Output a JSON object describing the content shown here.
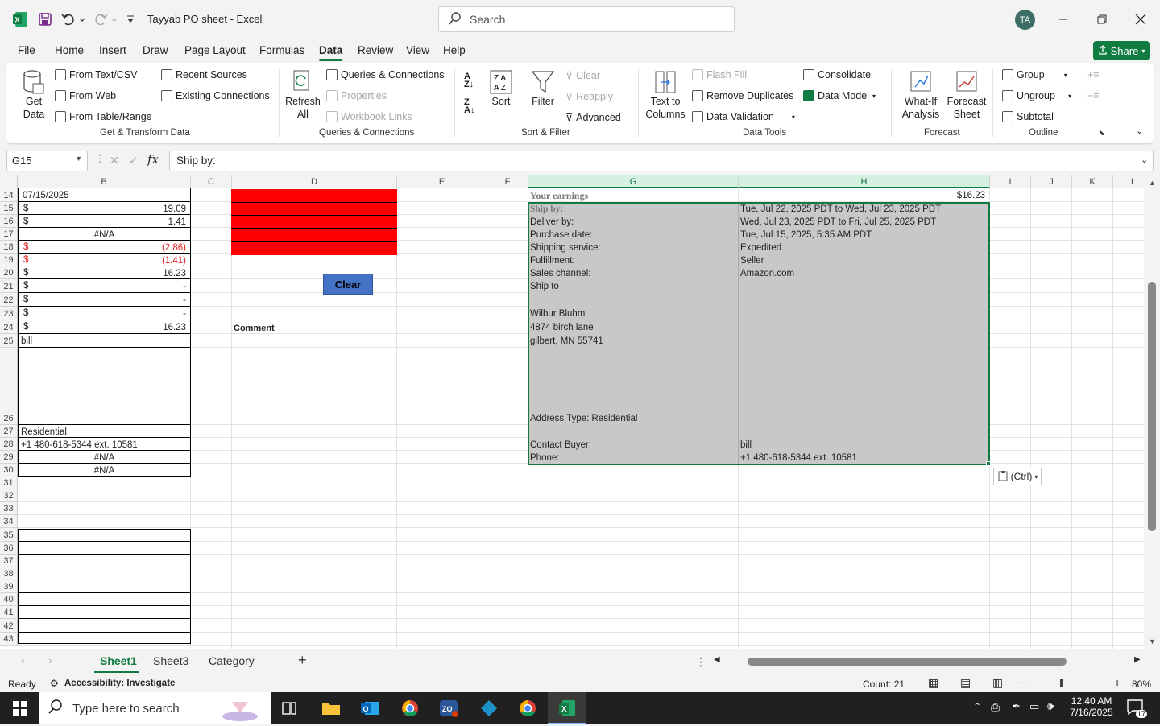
{
  "window": {
    "title": "Tayyab PO sheet  -  Excel",
    "search_placeholder": "Search",
    "avatar": "TA"
  },
  "menu": [
    "File",
    "Home",
    "Insert",
    "Draw",
    "Page Layout",
    "Formulas",
    "Data",
    "Review",
    "View",
    "Help"
  ],
  "share_label": "Share",
  "ribbon": {
    "get_data": "Get\nData",
    "from_text_csv": "From Text/CSV",
    "from_web": "From Web",
    "from_table_range": "From Table/Range",
    "recent_sources": "Recent Sources",
    "existing_connections": "Existing Connections",
    "refresh_all": "Refresh\nAll",
    "queries_connections": "Queries & Connections",
    "properties": "Properties",
    "workbook_links": "Workbook Links",
    "sort": "Sort",
    "filter": "Filter",
    "clear": "Clear",
    "reapply": "Reapply",
    "advanced": "Advanced",
    "text_to_columns": "Text to\nColumns",
    "flash_fill": "Flash Fill",
    "remove_duplicates": "Remove Duplicates",
    "data_validation": "Data Validation",
    "consolidate": "Consolidate",
    "data_model": "Data Model",
    "what_if": "What-If\nAnalysis",
    "forecast_sheet": "Forecast\nSheet",
    "group": "Group",
    "ungroup": "Ungroup",
    "subtotal": "Subtotal",
    "groups": {
      "get_transform": "Get & Transform Data",
      "queries": "Queries & Connections",
      "sort_filter": "Sort & Filter",
      "data_tools": "Data Tools",
      "forecast": "Forecast",
      "outline": "Outline"
    }
  },
  "formula_bar": {
    "name_box": "G15",
    "formula": "Ship by:"
  },
  "columns": [
    "B",
    "C",
    "D",
    "E",
    "F",
    "G",
    "H",
    "I",
    "J",
    "K",
    "L"
  ],
  "rows": [
    "14",
    "15",
    "16",
    "17",
    "18",
    "19",
    "20",
    "21",
    "22",
    "23",
    "24",
    "25",
    "26",
    "27",
    "28",
    "29",
    "30",
    "31",
    "32",
    "33",
    "34",
    "35",
    "36",
    "37",
    "38",
    "39",
    "40",
    "41",
    "42",
    "43"
  ],
  "colB": {
    "r14": "07/15/2025",
    "r15": "19.09",
    "r16": "1.41",
    "r17": "#N/A",
    "r18": "(2.86)",
    "r19": "(1.41)",
    "r20": "16.23",
    "r21": "-",
    "r22": "-",
    "r23": "-",
    "r24": "16.23",
    "r25": "bill",
    "r27": "Residential",
    "r28": "+1 480-618-5344 ext. 10581",
    "r29": "#N/A",
    "r30": "#N/A",
    "currency": "$"
  },
  "colD": {
    "comment": "Comment",
    "clear_button": "Clear"
  },
  "order": {
    "earnings_label": "Your earnings",
    "earnings_value": "$16.23",
    "ship_by_label": "Ship by:",
    "ship_by": "Tue, Jul 22, 2025 PDT to Wed, Jul 23, 2025 PDT",
    "deliver_by_label": "Deliver by:",
    "deliver_by": "Wed, Jul 23, 2025 PDT to Fri, Jul 25, 2025 PDT",
    "purchase_date_label": "Purchase date:",
    "purchase_date": "Tue, Jul 15, 2025, 5:35 AM PDT",
    "shipping_service_label": "Shipping service:",
    "shipping_service": "Expedited",
    "fulfillment_label": "Fulfillment:",
    "fulfillment": "Seller",
    "sales_channel_label": "Sales channel:",
    "sales_channel": "Amazon.com",
    "ship_to_label": "Ship to",
    "name": "Wilbur Bluhm",
    "street": "4874 birch lane",
    "city": "gilbert, MN 55741",
    "address_type": "Address Type:  Residential",
    "contact_buyer_label": "Contact Buyer:",
    "contact_buyer": "bill",
    "phone_label": "Phone:",
    "phone": "+1 480-618-5344 ext. 10581"
  },
  "paste_options": "(Ctrl)",
  "sheets": [
    "Sheet1",
    "Sheet3",
    "Category"
  ],
  "status": {
    "ready": "Ready",
    "accessibility": "Accessibility: Investigate",
    "count": "Count: 21",
    "zoom": "80%"
  },
  "taskbar": {
    "search_placeholder": "Type here to search",
    "time": "12:40 AM",
    "date": "7/16/2025",
    "notifications": "17"
  },
  "colors": {
    "accent": "#107c41",
    "red_fill": "#ff0000",
    "selection": "#c8c8c8",
    "button_blue": "#4472c4"
  }
}
